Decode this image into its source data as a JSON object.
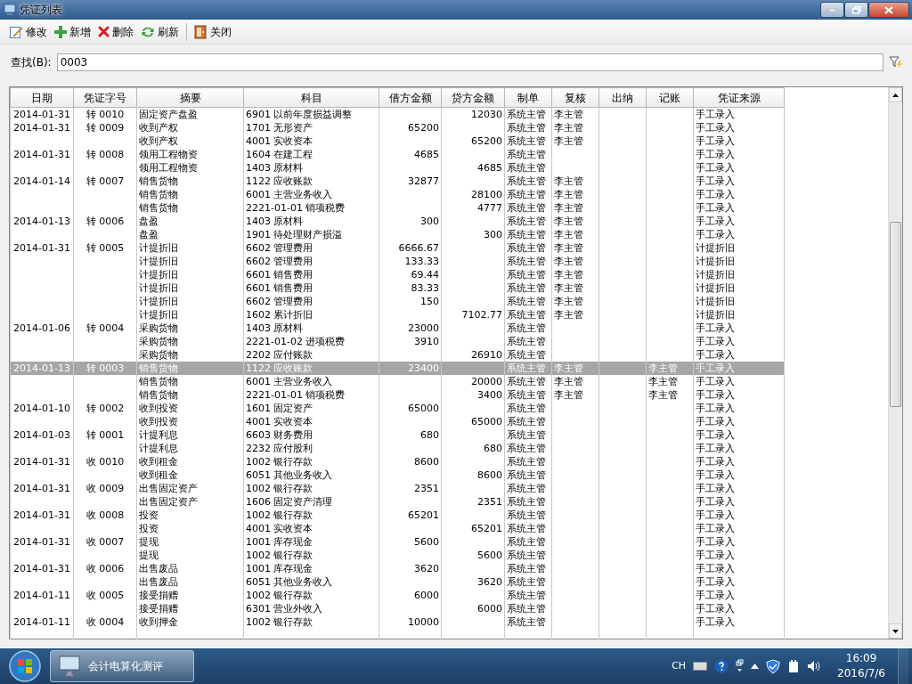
{
  "window": {
    "title": "凭证列表"
  },
  "toolbar": [
    {
      "label": "修改",
      "kind": "edit"
    },
    {
      "label": "新增",
      "kind": "add"
    },
    {
      "label": "删除",
      "kind": "delete"
    },
    {
      "label": "刷新",
      "kind": "refresh"
    },
    {
      "label": "关闭",
      "kind": "close"
    }
  ],
  "search": {
    "label": "查找(B):",
    "value": "0003"
  },
  "table": {
    "columns": [
      "日期",
      "凭证字号",
      "摘要",
      "科目",
      "借方金额",
      "贷方金额",
      "制单",
      "复核",
      "出纳",
      "记账",
      "凭证来源"
    ],
    "rows": [
      {
        "selected": false,
        "cells": [
          "2014-01-31",
          "转 0010",
          "固定资产盘盈",
          "6901 以前年度损益调整",
          "",
          "12030",
          "系统主管",
          "李主管",
          "",
          "",
          "手工录入"
        ]
      },
      {
        "selected": false,
        "cells": [
          "2014-01-31",
          "转 0009",
          "收到产权",
          "1701 无形资产",
          "65200",
          "",
          "系统主管",
          "李主管",
          "",
          "",
          "手工录入"
        ]
      },
      {
        "selected": false,
        "cells": [
          "",
          "",
          "收到产权",
          "4001 实收资本",
          "",
          "65200",
          "系统主管",
          "李主管",
          "",
          "",
          "手工录入"
        ]
      },
      {
        "selected": false,
        "cells": [
          "2014-01-31",
          "转 0008",
          "领用工程物资",
          "1604 在建工程",
          "4685",
          "",
          "系统主管",
          "",
          "",
          "",
          "手工录入"
        ]
      },
      {
        "selected": false,
        "cells": [
          "",
          "",
          "领用工程物资",
          "1403 原材料",
          "",
          "4685",
          "系统主管",
          "",
          "",
          "",
          "手工录入"
        ]
      },
      {
        "selected": false,
        "cells": [
          "2014-01-14",
          "转 0007",
          "销售货物",
          "1122 应收账款",
          "32877",
          "",
          "系统主管",
          "李主管",
          "",
          "",
          "手工录入"
        ]
      },
      {
        "selected": false,
        "cells": [
          "",
          "",
          "销售货物",
          "6001 主营业务收入",
          "",
          "28100",
          "系统主管",
          "李主管",
          "",
          "",
          "手工录入"
        ]
      },
      {
        "selected": false,
        "cells": [
          "",
          "",
          "销售货物",
          "2221-01-01 销项税费",
          "",
          "4777",
          "系统主管",
          "李主管",
          "",
          "",
          "手工录入"
        ]
      },
      {
        "selected": false,
        "cells": [
          "2014-01-13",
          "转 0006",
          "盘盈",
          "1403 原材料",
          "300",
          "",
          "系统主管",
          "李主管",
          "",
          "",
          "手工录入"
        ]
      },
      {
        "selected": false,
        "cells": [
          "",
          "",
          "盘盈",
          "1901 待处理财产损溢",
          "",
          "300",
          "系统主管",
          "李主管",
          "",
          "",
          "手工录入"
        ]
      },
      {
        "selected": false,
        "cells": [
          "2014-01-31",
          "转 0005",
          "计提折旧",
          "6602 管理费用",
          "6666.67",
          "",
          "系统主管",
          "李主管",
          "",
          "",
          "计提折旧"
        ]
      },
      {
        "selected": false,
        "cells": [
          "",
          "",
          "计提折旧",
          "6602 管理费用",
          "133.33",
          "",
          "系统主管",
          "李主管",
          "",
          "",
          "计提折旧"
        ]
      },
      {
        "selected": false,
        "cells": [
          "",
          "",
          "计提折旧",
          "6601 销售费用",
          "69.44",
          "",
          "系统主管",
          "李主管",
          "",
          "",
          "计提折旧"
        ]
      },
      {
        "selected": false,
        "cells": [
          "",
          "",
          "计提折旧",
          "6601 销售费用",
          "83.33",
          "",
          "系统主管",
          "李主管",
          "",
          "",
          "计提折旧"
        ]
      },
      {
        "selected": false,
        "cells": [
          "",
          "",
          "计提折旧",
          "6602 管理费用",
          "150",
          "",
          "系统主管",
          "李主管",
          "",
          "",
          "计提折旧"
        ]
      },
      {
        "selected": false,
        "cells": [
          "",
          "",
          "计提折旧",
          "1602 累计折旧",
          "",
          "7102.77",
          "系统主管",
          "李主管",
          "",
          "",
          "计提折旧"
        ]
      },
      {
        "selected": false,
        "cells": [
          "2014-01-06",
          "转 0004",
          "采购货物",
          "1403 原材料",
          "23000",
          "",
          "系统主管",
          "",
          "",
          "",
          "手工录入"
        ]
      },
      {
        "selected": false,
        "cells": [
          "",
          "",
          "采购货物",
          "2221-01-02 进项税费",
          "3910",
          "",
          "系统主管",
          "",
          "",
          "",
          "手工录入"
        ]
      },
      {
        "selected": false,
        "cells": [
          "",
          "",
          "采购货物",
          "2202 应付账款",
          "",
          "26910",
          "系统主管",
          "",
          "",
          "",
          "手工录入"
        ]
      },
      {
        "selected": true,
        "cells": [
          "2014-01-13",
          "转 0003",
          "销售货物",
          "1122 应收账款",
          "23400",
          "",
          "系统主管",
          "李主管",
          "",
          "李主管",
          "手工录入"
        ]
      },
      {
        "selected": false,
        "cells": [
          "",
          "",
          "销售货物",
          "6001 主营业务收入",
          "",
          "20000",
          "系统主管",
          "李主管",
          "",
          "李主管",
          "手工录入"
        ]
      },
      {
        "selected": false,
        "cells": [
          "",
          "",
          "销售货物",
          "2221-01-01 销项税费",
          "",
          "3400",
          "系统主管",
          "李主管",
          "",
          "李主管",
          "手工录入"
        ]
      },
      {
        "selected": false,
        "cells": [
          "2014-01-10",
          "转 0002",
          "收到投资",
          "1601 固定资产",
          "65000",
          "",
          "系统主管",
          "",
          "",
          "",
          "手工录入"
        ]
      },
      {
        "selected": false,
        "cells": [
          "",
          "",
          "收到投资",
          "4001 实收资本",
          "",
          "65000",
          "系统主管",
          "",
          "",
          "",
          "手工录入"
        ]
      },
      {
        "selected": false,
        "cells": [
          "2014-01-03",
          "转 0001",
          "计提利息",
          "6603 财务费用",
          "680",
          "",
          "系统主管",
          "",
          "",
          "",
          "手工录入"
        ]
      },
      {
        "selected": false,
        "cells": [
          "",
          "",
          "计提利息",
          "2232 应付股利",
          "",
          "680",
          "系统主管",
          "",
          "",
          "",
          "手工录入"
        ]
      },
      {
        "selected": false,
        "cells": [
          "2014-01-31",
          "收 0010",
          "收到租金",
          "1002 银行存款",
          "8600",
          "",
          "系统主管",
          "",
          "",
          "",
          "手工录入"
        ]
      },
      {
        "selected": false,
        "cells": [
          "",
          "",
          "收到租金",
          "6051 其他业务收入",
          "",
          "8600",
          "系统主管",
          "",
          "",
          "",
          "手工录入"
        ]
      },
      {
        "selected": false,
        "cells": [
          "2014-01-31",
          "收 0009",
          "出售固定资产",
          "1002 银行存款",
          "2351",
          "",
          "系统主管",
          "",
          "",
          "",
          "手工录入"
        ]
      },
      {
        "selected": false,
        "cells": [
          "",
          "",
          "出售固定资产",
          "1606 固定资产清理",
          "",
          "2351",
          "系统主管",
          "",
          "",
          "",
          "手工录入"
        ]
      },
      {
        "selected": false,
        "cells": [
          "2014-01-31",
          "收 0008",
          "投资",
          "1002 银行存款",
          "65201",
          "",
          "系统主管",
          "",
          "",
          "",
          "手工录入"
        ]
      },
      {
        "selected": false,
        "cells": [
          "",
          "",
          "投资",
          "4001 实收资本",
          "",
          "65201",
          "系统主管",
          "",
          "",
          "",
          "手工录入"
        ]
      },
      {
        "selected": false,
        "cells": [
          "2014-01-31",
          "收 0007",
          "提现",
          "1001 库存现金",
          "5600",
          "",
          "系统主管",
          "",
          "",
          "",
          "手工录入"
        ]
      },
      {
        "selected": false,
        "cells": [
          "",
          "",
          "提现",
          "1002 银行存款",
          "",
          "5600",
          "系统主管",
          "",
          "",
          "",
          "手工录入"
        ]
      },
      {
        "selected": false,
        "cells": [
          "2014-01-31",
          "收 0006",
          "出售废品",
          "1001 库存现金",
          "3620",
          "",
          "系统主管",
          "",
          "",
          "",
          "手工录入"
        ]
      },
      {
        "selected": false,
        "cells": [
          "",
          "",
          "出售废品",
          "6051 其他业务收入",
          "",
          "3620",
          "系统主管",
          "",
          "",
          "",
          "手工录入"
        ]
      },
      {
        "selected": false,
        "cells": [
          "2014-01-11",
          "收 0005",
          "接受捐赠",
          "1002 银行存款",
          "6000",
          "",
          "系统主管",
          "",
          "",
          "",
          "手工录入"
        ]
      },
      {
        "selected": false,
        "cells": [
          "",
          "",
          "接受捐赠",
          "6301 营业外收入",
          "",
          "6000",
          "系统主管",
          "",
          "",
          "",
          "手工录入"
        ]
      },
      {
        "selected": false,
        "cells": [
          "2014-01-11",
          "收 0004",
          "收到押金",
          "1002 银行存款",
          "10000",
          "",
          "系统主管",
          "",
          "",
          "",
          "手工录入"
        ]
      }
    ]
  },
  "taskbar": {
    "app": "会计电算化测评",
    "language": "CH",
    "time": "16:09",
    "date": "2016/7/6"
  }
}
